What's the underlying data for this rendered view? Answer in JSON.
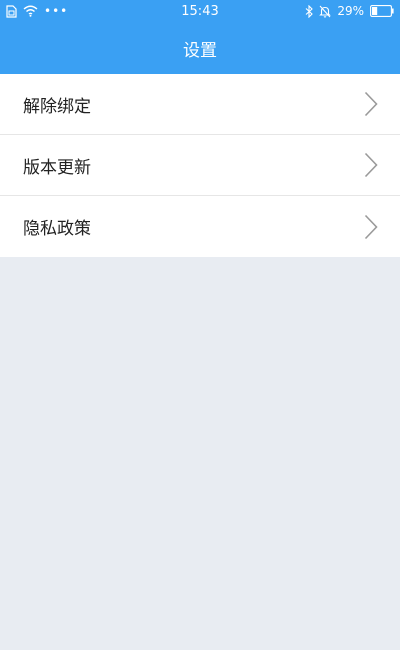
{
  "status_bar": {
    "time": "15:43",
    "battery_percent": "29%",
    "left_icons": [
      "sim-icon",
      "wifi-icon",
      "more-dots-icon"
    ],
    "right_icons": [
      "bluetooth-icon",
      "mute-bell-icon",
      "battery-icon"
    ],
    "battery_level": 0.29
  },
  "header": {
    "title": "设置"
  },
  "menu": {
    "items": [
      {
        "label": "解除绑定",
        "icon": "chevron-right-icon"
      },
      {
        "label": "版本更新",
        "icon": "chevron-right-icon"
      },
      {
        "label": "隐私政策",
        "icon": "chevron-right-icon"
      }
    ]
  },
  "colors": {
    "primary": "#3aa0f3",
    "background": "#e8ecf2",
    "list_background": "#ffffff",
    "text": "#222222",
    "chevron": "#9a9a9a"
  }
}
